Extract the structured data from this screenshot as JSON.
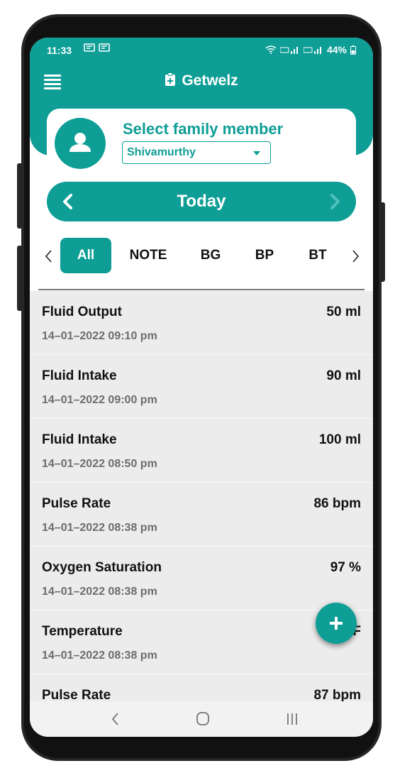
{
  "status_bar": {
    "time": "11:33",
    "battery": "44%"
  },
  "app": {
    "title": "Getwelz"
  },
  "member": {
    "title": "Select family member",
    "selected": "Shivamurthy"
  },
  "date": {
    "label": "Today"
  },
  "filters": [
    "All",
    "NOTE",
    "BG",
    "BP",
    "BT"
  ],
  "entries": [
    {
      "name": "Fluid Output",
      "value": "50 ml",
      "time": "14–01–2022 09:10 pm"
    },
    {
      "name": "Fluid Intake",
      "value": "90 ml",
      "time": "14–01–2022 09:00 pm"
    },
    {
      "name": "Fluid Intake",
      "value": "100 ml",
      "time": "14–01–2022 08:50 pm"
    },
    {
      "name": "Pulse Rate",
      "value": "86 bpm",
      "time": "14–01–2022 08:38 pm"
    },
    {
      "name": "Oxygen Saturation",
      "value": "97 %",
      "time": "14–01–2022 08:38 pm"
    },
    {
      "name": "Temperature",
      "value": "9  F",
      "time": "14–01–2022 08:38 pm"
    },
    {
      "name": "Pulse Rate",
      "value": "87 bpm",
      "time": ""
    }
  ],
  "colors": {
    "primary": "#0e9e96",
    "list_bg": "#ececec"
  },
  "icons": [
    "menu-icon",
    "clipboard-icon",
    "avatar-icon",
    "chevron-left-icon",
    "chevron-right-icon",
    "plus-icon",
    "nav-back-icon",
    "nav-home-icon",
    "nav-recent-icon"
  ]
}
